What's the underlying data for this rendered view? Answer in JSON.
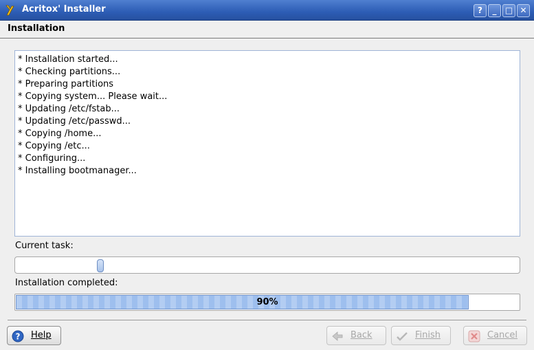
{
  "window": {
    "title": "Acritox' Installer",
    "buttons": {
      "help": "?",
      "minimize": "_",
      "maximize": "□",
      "close": "✕"
    },
    "accent": "#2d5db5"
  },
  "page": {
    "title": "Installation"
  },
  "log": {
    "lines": [
      "* Installation started...",
      "* Checking partitions...",
      "* Preparing partitions",
      "* Copying system... Please wait...",
      "* Updating /etc/fstab...",
      "* Updating /etc/passwd...",
      "* Copying /home...",
      "* Copying /etc...",
      "* Configuring...",
      "* Installing bootmanager..."
    ]
  },
  "current_task": {
    "label": "Current task:",
    "position_fraction": 0.165
  },
  "overall": {
    "label": "Installation completed:",
    "percent": 90,
    "percent_text": "90%"
  },
  "buttons": {
    "help": {
      "label": "Help",
      "icon": "help-icon",
      "enabled": true
    },
    "back": {
      "label": "Back",
      "icon": "back-arrow-icon",
      "enabled": false
    },
    "finish": {
      "label": "Finish",
      "icon": "checkmark-icon",
      "enabled": false
    },
    "cancel": {
      "label": "Cancel",
      "icon": "cancel-icon",
      "enabled": false
    }
  }
}
